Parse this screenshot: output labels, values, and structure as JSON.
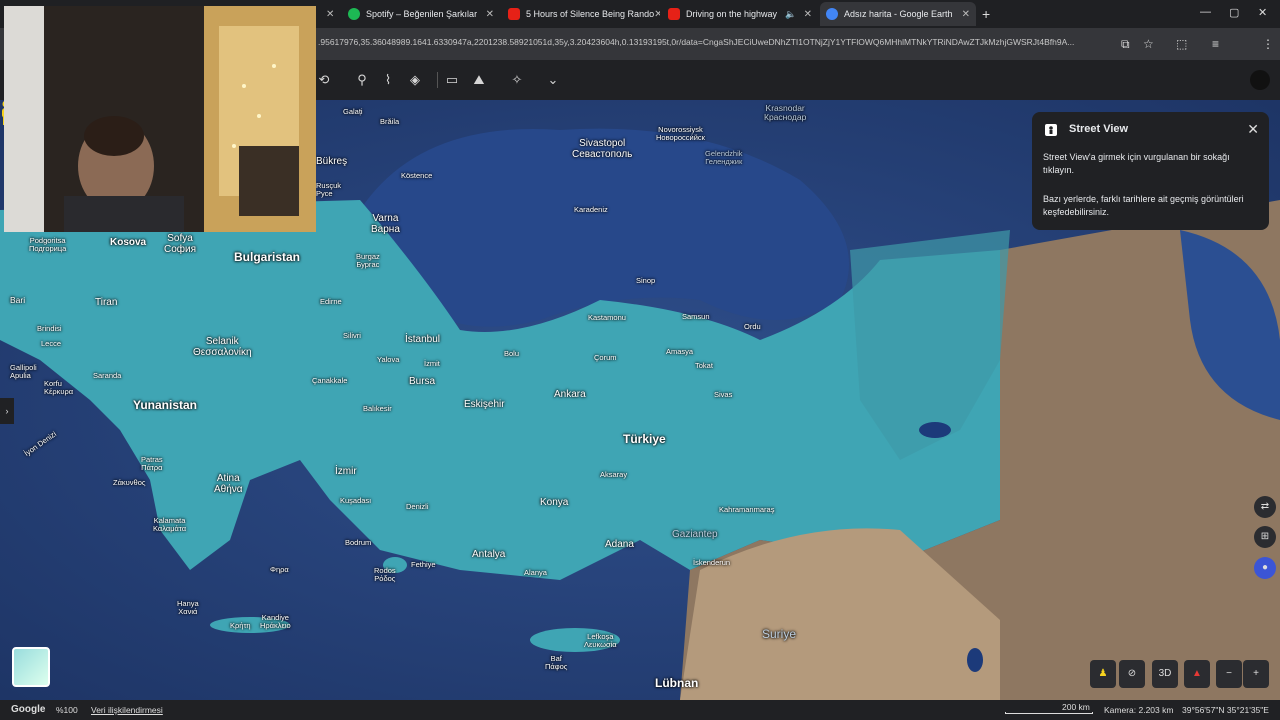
{
  "tabs": [
    {
      "title": "Spotify – Beğenilen Şarkılar",
      "favicon_color": "#1db954"
    },
    {
      "title": "5 Hours of Silence Being Rando",
      "favicon_color": "#e62117"
    },
    {
      "title": "Driving on the highway",
      "favicon_color": "#e62117"
    },
    {
      "title": "Adsız harita - Google Earth",
      "favicon_color": "#4285f4"
    }
  ],
  "url": ".95617976,35.36048989.1641.6330947a,2201238.58921051d,35y,3.20423604h,0.13193195t,0r/data=CngaShJECiUweDNhZTI1OTNjZjY1YTFlOWQ6MHhlMTNkYTRiNDAwZTJkMzhjGWSRJt4Bfh9A...",
  "map_labels": {
    "krasnodar": "Krasnodar\nКраснодар",
    "galati": "Galați",
    "braila": "Brăila",
    "novorossiysk": "Novorossiysk\nНоворосси́йск",
    "sivastopol": "Sivastopol\nСевастополь",
    "gelendzhik": "Gelendzhik\nГеленджик",
    "bukres": "Bükreş",
    "kostence": "Köstence",
    "karadeniz": "Karadeniz",
    "rusçuk": "Rusçuk\nРусе",
    "varna": "Varna\nВарна",
    "kosova": "Kosova",
    "sofya": "Sofya\nСофия",
    "podgorica": "Podgoritsa\nПодгорица",
    "bulgaristan": "Bulgaristan",
    "burgaz": "Burgaz\nБургас",
    "sinop": "Sinop",
    "bari": "Bari",
    "tiran": "Tiran",
    "edirne": "Edirne",
    "kastamonu": "Kastamonu",
    "samsun": "Samsun",
    "ordu": "Ordu",
    "brindisi": "Brindisi",
    "lecce": "Lecce",
    "selanik": "Selanik\nΘεσσαλονίκη",
    "silivri": "Silivri",
    "istanbul": "İstanbul",
    "bolu": "Bolu",
    "amasya": "Amasya",
    "gallipoli": "Gallipoli\nApulia",
    "korfu": "Korfu\nΚέρκυρα",
    "saranda": "Saranda",
    "yalova": "Yalova",
    "izmit": "İzmit",
    "corum": "Çorum",
    "tokat": "Tokat",
    "canakkale": "Çanakkale",
    "bursa": "Bursa",
    "ankara": "Ankara",
    "yunanistan": "Yunanistan",
    "balikesir": "Balıkesir",
    "eskisehir": "Eskişehir",
    "sivas": "Sivas",
    "turkiye": "Türkiye",
    "iyon": "İyon Denizi",
    "patras": "Patras\nΠάτρα",
    "izmir": "İzmir",
    "aksaray": "Aksaray",
    "atina": "Atina\nΑθήνα",
    "zakynthos": "Ζάκυνθος",
    "denizli": "Denizli",
    "kusadasi": "Kuşadası",
    "konya": "Konya",
    "kahramanmaras": "Kahramanmaraş",
    "kalamata": "Kalamata\nΚαλαμάτα",
    "bodrum": "Bodrum",
    "adana": "Adana",
    "gaziantep": "Gaziantep",
    "antalya": "Antalya",
    "rodos": "Rodos\nΡόδος",
    "fethiye": "Fethiye",
    "alanya": "Alanya",
    "iskenderun": "İskenderun",
    "fira": "Φηρα",
    "hanya": "Hanya\nΧανιά",
    "kandiye": "Kandiye\nΗράκλειο",
    "kriti": "Κρήτη",
    "lefkosa": "Lefkoşa\nΛευκωσία",
    "baf": "Baf\nΠάφος",
    "suriye": "Suriye",
    "lubnan": "Lübnan"
  },
  "street_view": {
    "title": "Street View",
    "line1": "Street View'a girmek için vurgulanan bir sokağı tıklayın.",
    "line2": "Bazı yerlerde, farklı tarihlere ait geçmiş görüntüleri keşfedebilirsiniz."
  },
  "controls": {
    "three_d": "3D"
  },
  "status": {
    "brand": "Google",
    "zoom": "%100",
    "data_attribution": "Veri ilişkilendirmesi",
    "scale": "200 km",
    "camera": "Kamera: 2.203 km",
    "coords": "39°56'57\"N 35°21'35\"E"
  }
}
